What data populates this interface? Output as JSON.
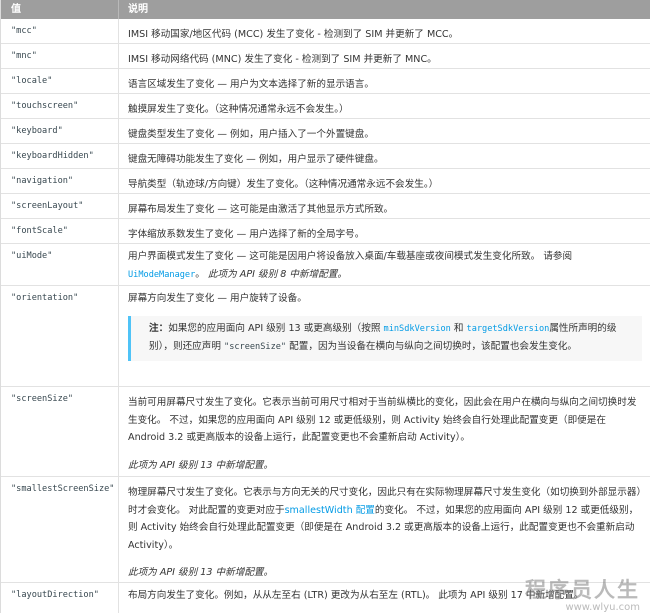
{
  "header": {
    "col_value": "值",
    "col_desc": "说明"
  },
  "rows": [
    {
      "key": "\"mcc\"",
      "desc": "IMSI 移动国家/地区代码 (MCC) 发生了变化 - 检测到了 SIM 并更新了 MCC。"
    },
    {
      "key": "\"mnc\"",
      "desc": "IMSI 移动网络代码 (MNC) 发生了变化 - 检测到了 SIM 并更新了 MNC。"
    },
    {
      "key": "\"locale\"",
      "desc": "语言区域发生了变化 — 用户为文本选择了新的显示语言。"
    },
    {
      "key": "\"touchscreen\"",
      "desc": "触摸屏发生了变化。（这种情况通常永远不会发生。）"
    },
    {
      "key": "\"keyboard\"",
      "desc": "键盘类型发生了变化 — 例如，用户插入了一个外置键盘。"
    },
    {
      "key": "\"keyboardHidden\"",
      "desc": "键盘无障碍功能发生了变化 — 例如，用户显示了硬件键盘。"
    },
    {
      "key": "\"navigation\"",
      "desc": "导航类型（轨迹球/方向键）发生了变化。（这种情况通常永远不会发生。）"
    },
    {
      "key": "\"screenLayout\"",
      "desc": "屏幕布局发生了变化 — 这可能是由激活了其他显示方式所致。"
    },
    {
      "key": "\"fontScale\"",
      "desc": "字体缩放系数发生了变化 — 用户选择了新的全局字号。"
    }
  ],
  "uimode": {
    "key": "\"uiMode\"",
    "desc": "用户界面模式发生了变化 — 这可能是因用户将设备放入桌面/车载基座或夜间模式发生变化所致。 请参阅",
    "link": "UiModeManager",
    "added": "此项为 API 级别 8 中新增配置。"
  },
  "orientation": {
    "key": "\"orientation\"",
    "desc": "屏幕方向发生了变化 — 用户旋转了设备。",
    "note_label": "注：",
    "note_p1": "如果您的应用面向 API 级别 13 或更高级别（按照",
    "note_link1": "minSdkVersion",
    "note_and": "和",
    "note_link2": "targetSdkVersion",
    "note_p2": "属性所声明的级别），则还应声明",
    "note_code": "\"screenSize\"",
    "note_p3": "配置，因为当设备在横向与纵向之间切换时，该配置也会发生变化。"
  },
  "screensize": {
    "key": "\"screenSize\"",
    "desc": "当前可用屏幕尺寸发生了变化。它表示当前可用尺寸相对于当前纵横比的变化，因此会在用户在横向与纵向之间切换时发生变化。 不过，如果您的应用面向 API 级别 12 或更低级别，则 Activity 始终会自行处理此配置变更（即便是在 Android 3.2 或更高版本的设备上运行，此配置变更也不会重新启动 Activity）。",
    "added": "此项为 API 级别 13 中新增配置。"
  },
  "smallest": {
    "key": "\"smallestScreenSize\"",
    "desc_p1": "物理屏幕尺寸发生了变化。它表示与方向无关的尺寸变化，因此只有在实际物理屏幕尺寸发生变化（如切换到外部显示器）时才会变化。 对此配置的变更对应于",
    "link": "smallestWidth 配置",
    "desc_p2": "的变化。 不过，如果您的应用面向 API 级别 12 或更低级别，则 Activity 始终会自行处理此配置变更（即便是在 Android 3.2 或更高版本的设备上运行，此配置变更也不会重新启动 Activity）。",
    "added": "此项为 API 级别 13 中新增配置。"
  },
  "layoutdir": {
    "key": "\"layoutDirection\"",
    "desc": "布局方向发生了变化。例如，从从左至右 (LTR) 更改为从右至左 (RTL)。 此项为 API 级别 17 中新增配置。"
  },
  "watermark": {
    "title": "程序员人生",
    "url": "www.wlyu.com"
  }
}
